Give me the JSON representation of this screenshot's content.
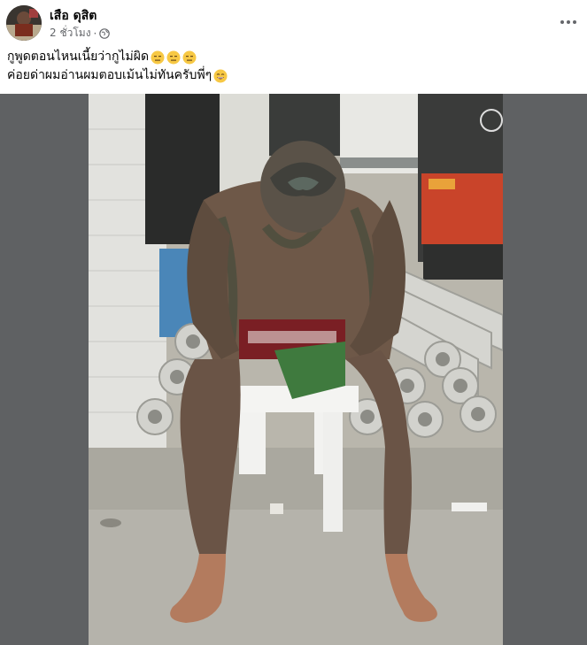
{
  "post": {
    "author": "เสือ ดุสิต",
    "time": "2 ชั่วโมง",
    "separator": "·",
    "audience_icon": "globe-icon",
    "more_icon": "more-options-icon",
    "more_label": "•••",
    "text_line_1": "กูพูดตอนไหนเนี้ยว่ากูไม่ผิด",
    "text_line_2": "ค่อยด่าผมอ่านผมตอบเม้นไม่ทันครับพี่ๆ",
    "line_1_emojis": [
      "expressionless-face-icon",
      "expressionless-face-icon",
      "expressionless-face-icon"
    ],
    "line_2_emoji": "grinning-face-icon"
  },
  "photo": {
    "description_icon": "post-photo",
    "background_color": "#5f6163"
  }
}
